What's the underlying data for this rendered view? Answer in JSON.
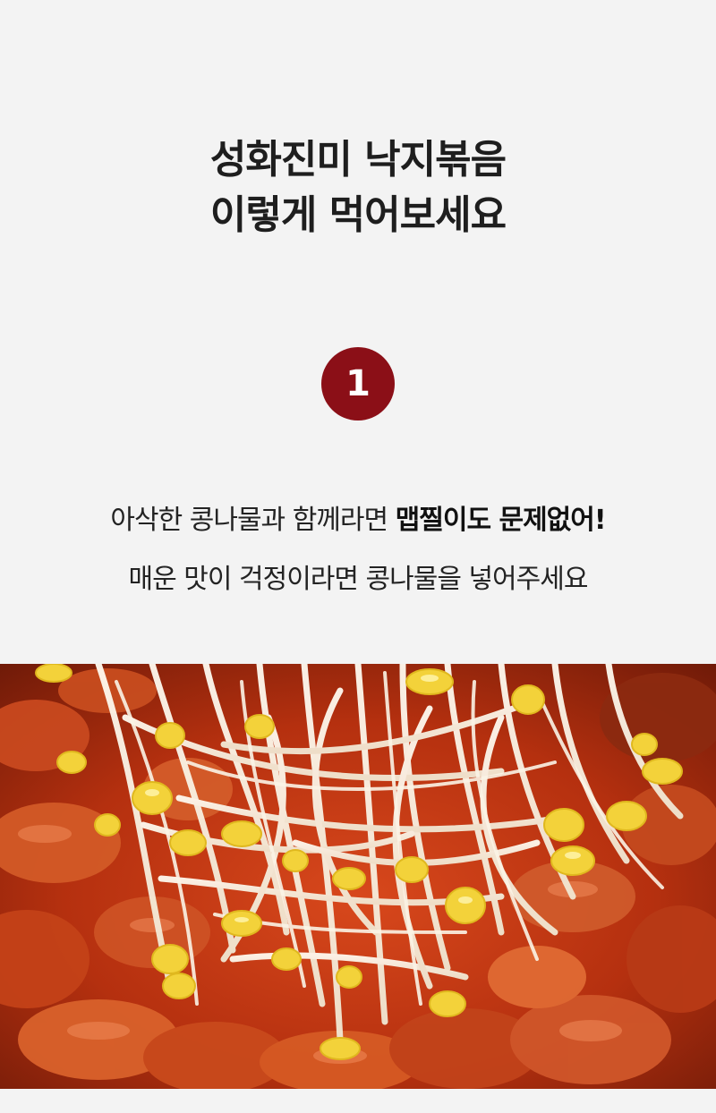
{
  "title": {
    "line1": "성화진미 낙지볶음",
    "line2": "이렇게 먹어보세요"
  },
  "step": {
    "number": "1",
    "badge_color": "#8b0f17"
  },
  "description": {
    "line1_normal": "아삭한 콩나물과 함께라면 ",
    "line1_bold": "맵찔이도 문제없어!",
    "line2": "매운 맛이 걱정이라면 콩나물을 넣어주세요"
  },
  "photo": {
    "subject": "stir-fried-octopus-with-bean-sprouts"
  },
  "colors": {
    "background": "#f3f3f3",
    "text": "#1f1f1f",
    "accent": "#8b0f17"
  }
}
